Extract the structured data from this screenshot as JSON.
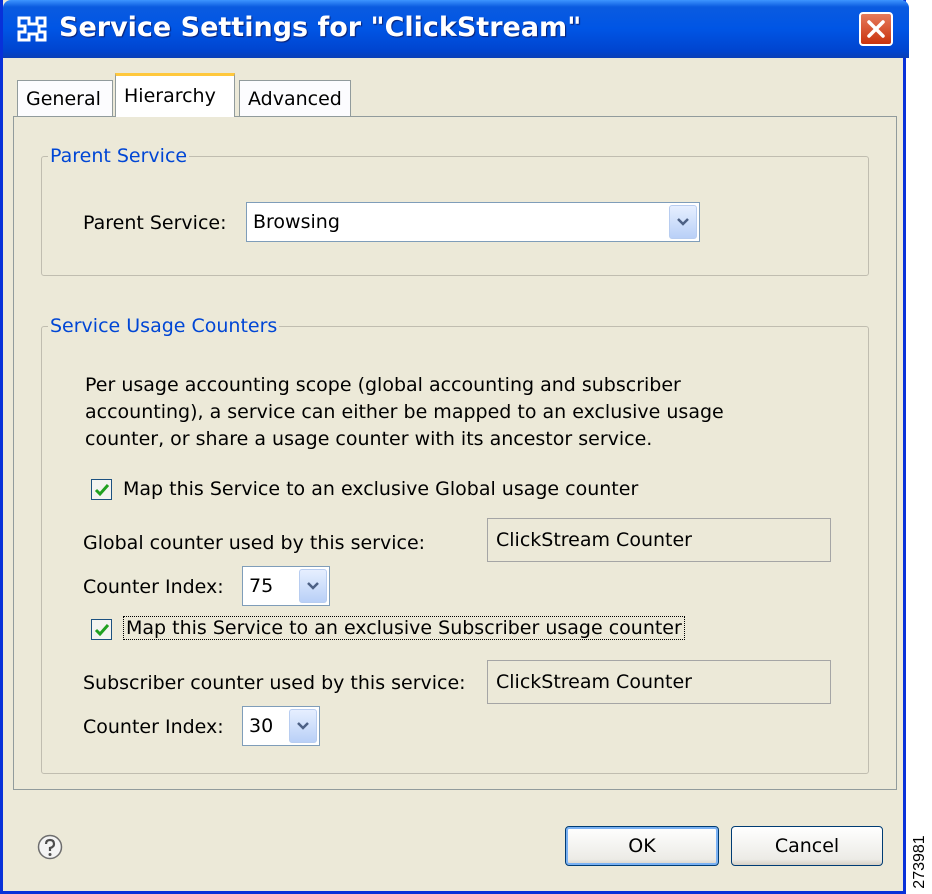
{
  "window": {
    "title": "Service Settings for \"ClickStream\""
  },
  "tabs": [
    {
      "label": "General"
    },
    {
      "label": "Hierarchy",
      "selected": true
    },
    {
      "label": "Advanced"
    }
  ],
  "parent_service": {
    "legend": "Parent Service",
    "label": "Parent Service:",
    "value": "Browsing"
  },
  "usage_counters": {
    "legend": "Service Usage Counters",
    "description": "Per usage accounting scope (global accounting and subscriber accounting), a service can either be mapped to an exclusive usage counter, or share a usage counter with its ancestor service.",
    "global": {
      "checkbox_label": "Map this Service to an exclusive Global usage counter",
      "checked": true,
      "counter_label": "Global counter used by this service:",
      "counter_value": "ClickStream Counter",
      "index_label": "Counter Index:",
      "index_value": "75"
    },
    "subscriber": {
      "checkbox_label": "Map this Service to an exclusive Subscriber usage counter",
      "checked": true,
      "counter_label": "Subscriber counter used by this service:",
      "counter_value": "ClickStream Counter",
      "index_label": "Counter Index:",
      "index_value": "30"
    }
  },
  "buttons": {
    "ok": "OK",
    "cancel": "Cancel"
  },
  "side_label": "273981",
  "colors": {
    "titlebar": "#0055e5",
    "legend": "#0046d5",
    "dialog_bg": "#ece9d8",
    "check": "#21a121"
  },
  "icons": {
    "app": "service-hierarchy-icon",
    "close": "close-icon",
    "help": "help-icon",
    "dropdown": "chevron-down-icon"
  }
}
